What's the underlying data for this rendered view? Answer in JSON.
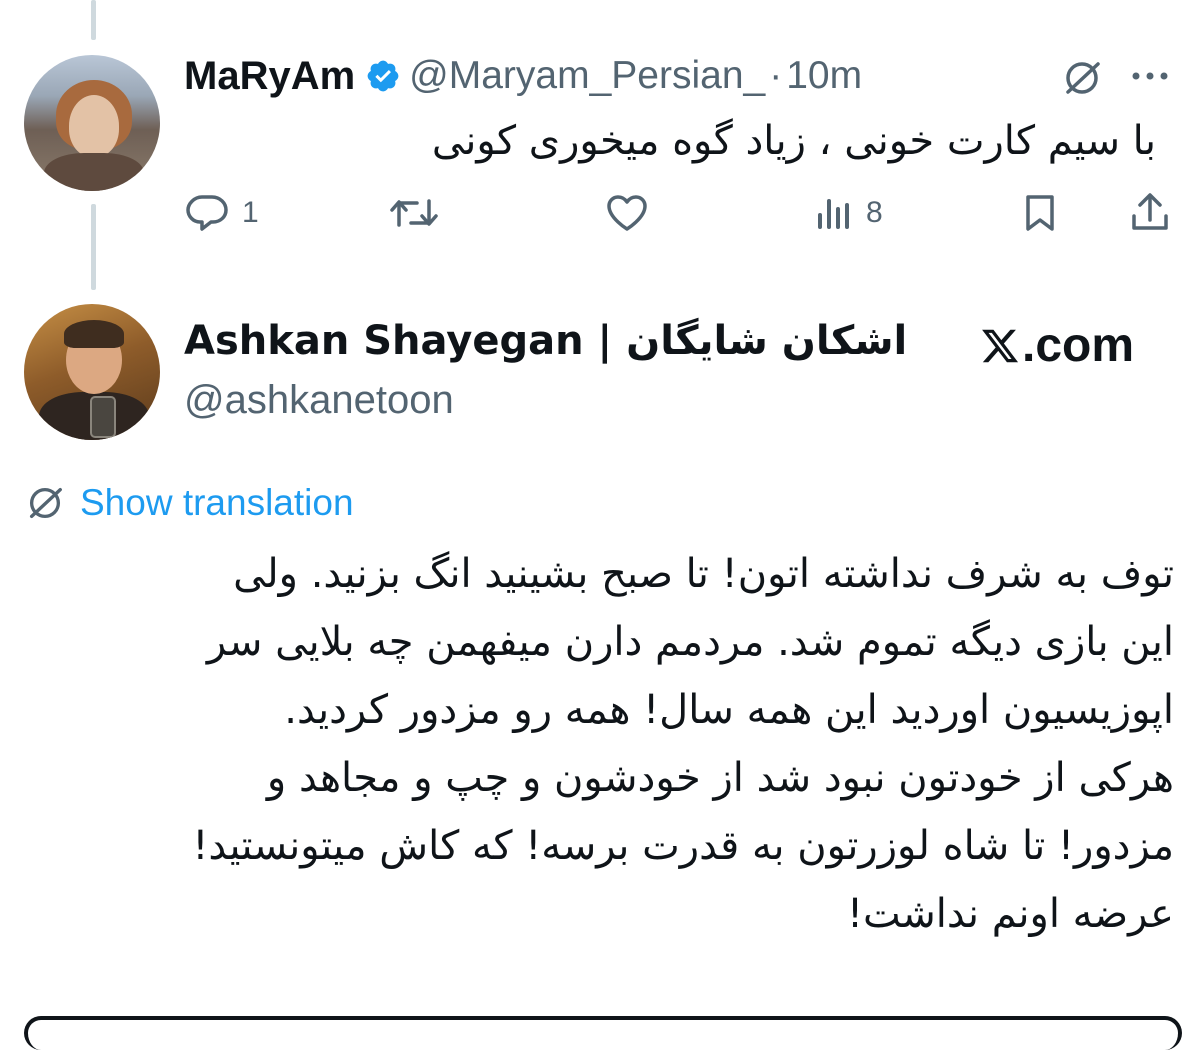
{
  "reply": {
    "display_name": "MaRyAm",
    "verified_icon": "verified-badge-icon",
    "handle": "@Maryam_Persian_",
    "separator": "·",
    "time": "10m",
    "text": "با سیم کارت خونی ، زیاد گوه میخوری کونی",
    "actions": {
      "reply_count": "1",
      "retweet_count": "",
      "like_count": "",
      "views_count": "8"
    }
  },
  "quoted": {
    "display_name": "Ashkan Shayegan | اشکان شایگان",
    "handle": "@ashkanetoon",
    "source_label": ".com",
    "show_translation": "Show translation",
    "lines": [
      "توف به شرف نداشته اتون! تا صبح بشینید انگ بزنید. ولی",
      "این بازی دیگه تموم شد. مردمم دارن میفهمن چه بلایی سر",
      "اپوزیسیون اوردید این همه سال! همه رو مزدور کردید.",
      "هرکی از خودتون نبود شد از خودشون و چپ و مجاهد و",
      "مزدور! تا شاه لوزرتون به قدرت برسه! که کاش میتونستید!",
      "عرضه اونم نداشت!"
    ]
  },
  "colors": {
    "text": "#0f1419",
    "secondary": "#536471",
    "link": "#1d9bf0",
    "verified": "#1d9bf0",
    "thread_line": "#cfd9de"
  }
}
